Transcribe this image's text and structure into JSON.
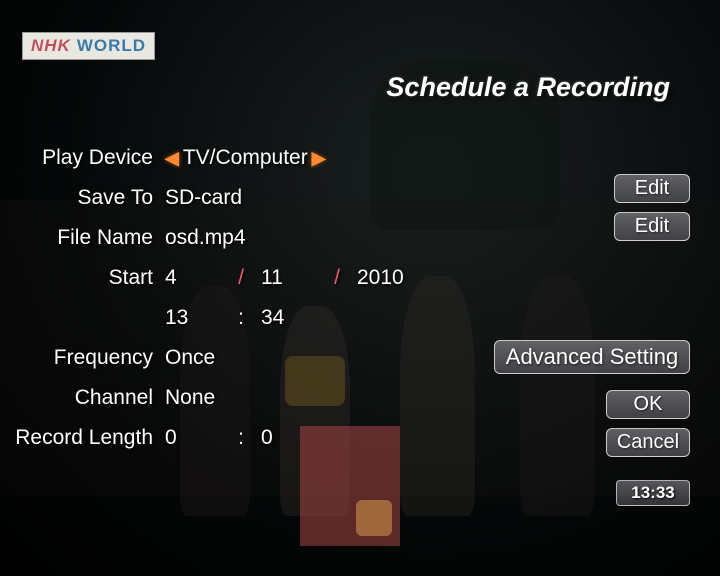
{
  "logo": {
    "left": "NHK",
    "right": "WORLD"
  },
  "title": "Schedule a Recording",
  "labels": {
    "play_device": "Play Device",
    "save_to": "Save To",
    "file_name": "File Name",
    "start": "Start",
    "frequency": "Frequency",
    "channel": "Channel",
    "record_length": "Record Length"
  },
  "values": {
    "play_device": "TV/Computer",
    "save_to": "SD-card",
    "file_name": "osd.mp4",
    "start_date": {
      "day": "4",
      "month": "11",
      "year": "2010"
    },
    "start_time": {
      "hour": "13",
      "minute": "34"
    },
    "frequency": "Once",
    "channel": "None",
    "record_length": {
      "hour": "0",
      "minute": "0"
    }
  },
  "buttons": {
    "edit": "Edit",
    "advanced": "Advanced Setting",
    "ok": "OK",
    "cancel": "Cancel"
  },
  "clock": "13:33"
}
